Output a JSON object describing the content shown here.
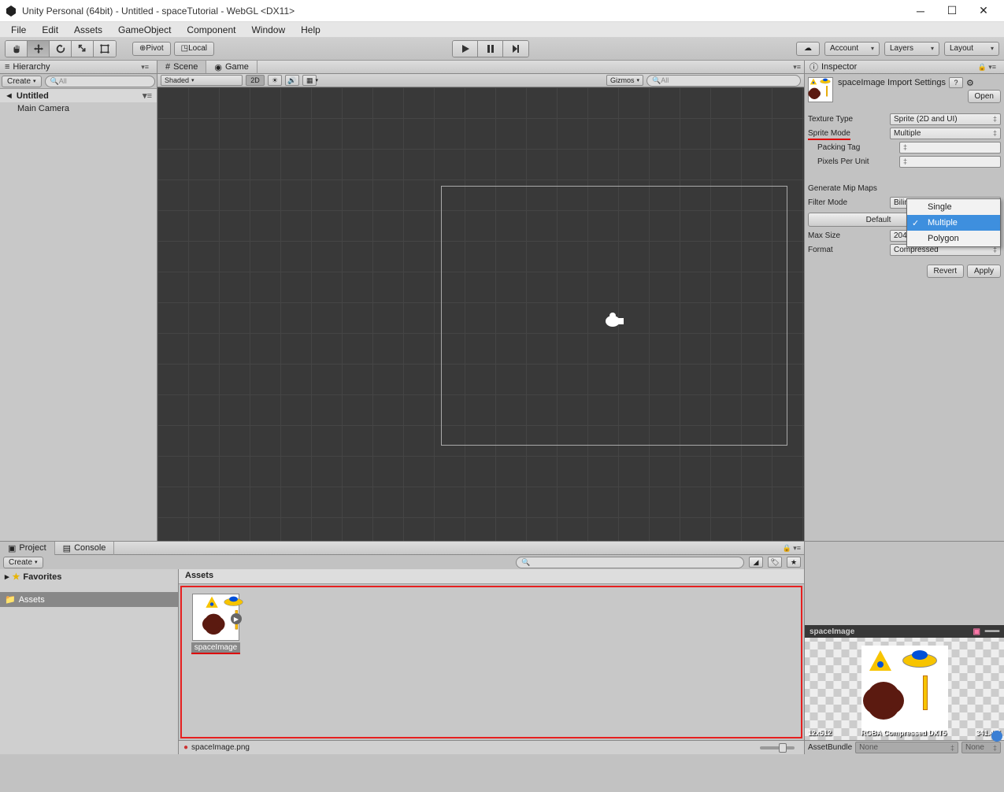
{
  "window": {
    "title": "Unity Personal (64bit) - Untitled - spaceTutorial - WebGL <DX11>"
  },
  "menubar": [
    "File",
    "Edit",
    "Assets",
    "GameObject",
    "Component",
    "Window",
    "Help"
  ],
  "toolbar": {
    "pivot_label": "Pivot",
    "local_label": "Local",
    "account_label": "Account",
    "layers_label": "Layers",
    "layout_label": "Layout"
  },
  "hierarchy": {
    "tab": "Hierarchy",
    "create": "Create",
    "search_placeholder": "All",
    "scene_name": "Untitled",
    "items": [
      "Main Camera"
    ]
  },
  "scene": {
    "tab_scene": "Scene",
    "tab_game": "Game",
    "shading": "Shaded",
    "mode_2d": "2D",
    "gizmos": "Gizmos",
    "search_placeholder": "All"
  },
  "inspector": {
    "tab": "Inspector",
    "title": "spaceImage Import Settings",
    "open_btn": "Open",
    "props": {
      "texture_type": {
        "label": "Texture Type",
        "value": "Sprite (2D and UI)"
      },
      "sprite_mode": {
        "label": "Sprite Mode",
        "value": "Multiple"
      },
      "packing_tag": {
        "label": "Packing Tag",
        "value": ""
      },
      "pixels_per_unit": {
        "label": "Pixels Per Unit",
        "value": ""
      },
      "generate_mip_maps": {
        "label": "Generate Mip Maps"
      },
      "filter_mode": {
        "label": "Filter Mode",
        "value": "Bilinear"
      },
      "default": "Default",
      "max_size": {
        "label": "Max Size",
        "value": "2048"
      },
      "format": {
        "label": "Format",
        "value": "Compressed"
      }
    },
    "revert": "Revert",
    "apply": "Apply",
    "dropdown_options": [
      "Single",
      "Multiple",
      "Polygon"
    ],
    "dropdown_selected": "Multiple"
  },
  "project": {
    "tab_project": "Project",
    "tab_console": "Console",
    "create": "Create",
    "favorites": "Favorites",
    "assets": "Assets",
    "assets_header": "Assets",
    "asset_item": "spaceImage",
    "status_file": "spaceImage.png"
  },
  "preview": {
    "title": "spaceImage",
    "info_left": "12x512",
    "info_mid": "RGBA Compressed DXT5",
    "info_right": "341.4 K",
    "assetbundle": "AssetBundle",
    "none": "None"
  }
}
